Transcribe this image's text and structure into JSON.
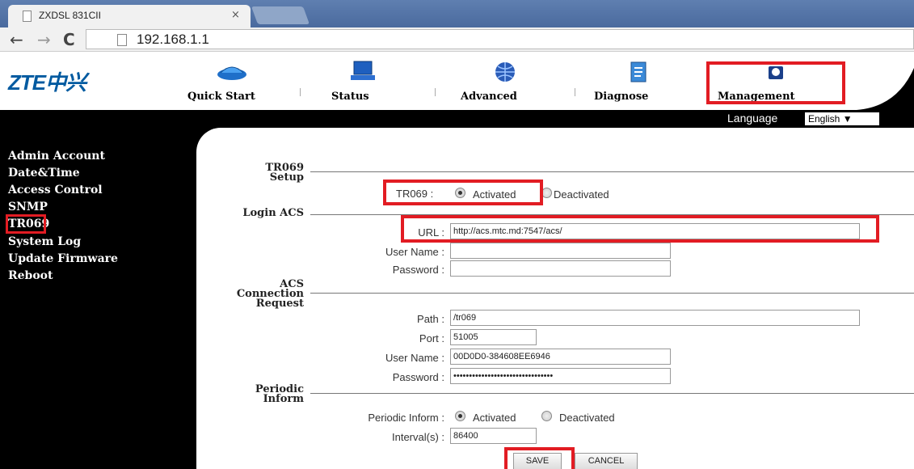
{
  "browser": {
    "tab_title": "ZXDSL 831CII",
    "tab_close": "×",
    "url": "192.168.1.1",
    "back": "←",
    "forward": "→",
    "reload": "C"
  },
  "header": {
    "logo": "ZTE中兴",
    "nav": [
      "Quick Start",
      "Status",
      "Advanced",
      "Diagnose",
      "Management"
    ],
    "language_label": "Language",
    "language_value": "English ▼"
  },
  "sidebar": {
    "items": [
      "Admin Account",
      "Date&Time",
      "Access Control",
      "SNMP",
      "TR069",
      "System Log",
      "Update Firmware",
      "Reboot"
    ]
  },
  "tr069_setup": {
    "title_line1": "TR069",
    "title_line2": "Setup",
    "label": "TR069 :",
    "activated": "Activated",
    "deactivated": "Deactivated"
  },
  "login_acs": {
    "title": "Login ACS",
    "url_label": "URL :",
    "url_value": "http://acs.mtc.md:7547/acs/",
    "username_label": "User Name :",
    "username_value": "",
    "password_label": "Password :",
    "password_value": ""
  },
  "acs_connection": {
    "title_line1": "ACS",
    "title_line2": "Connection",
    "title_line3": "Request",
    "path_label": "Path :",
    "path_value": "/tr069",
    "port_label": "Port :",
    "port_value": "51005",
    "username_label": "User Name :",
    "username_value": "00D0D0-384608EE6946",
    "password_label": "Password :",
    "password_value": "••••••••••••••••••••••••••••••••"
  },
  "periodic_inform": {
    "title_line1": "Periodic",
    "title_line2": "Inform",
    "label": "Periodic Inform :",
    "activated": "Activated",
    "deactivated": "Deactivated",
    "interval_label": "Interval(s) :",
    "interval_value": "86400"
  },
  "buttons": {
    "save": "SAVE",
    "cancel": "CANCEL"
  },
  "colors": {
    "highlight": "#e21c23",
    "logo": "#005aa0"
  }
}
